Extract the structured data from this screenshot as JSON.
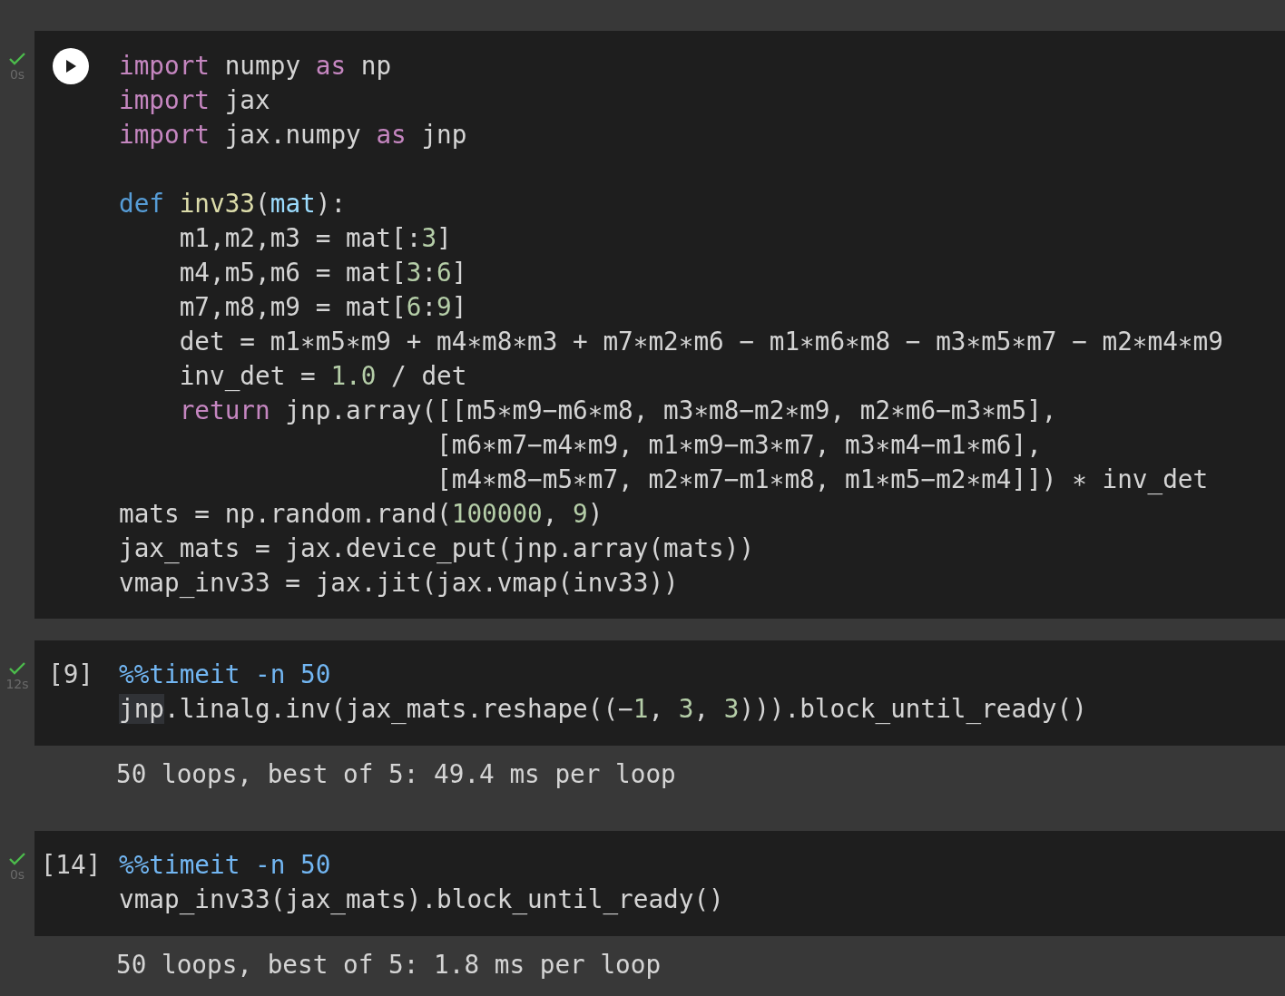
{
  "cells": [
    {
      "succeeded": true,
      "time": "0s",
      "prompt": {
        "kind": "run_button"
      },
      "lines": [
        {
          "kind": "code",
          "indented": false,
          "tokens": [
            {
              "t": "import",
              "kind": "keyword"
            },
            {
              "t": " numpy ",
              "kind": "plain"
            },
            {
              "t": "as",
              "kind": "keyword"
            },
            {
              "t": " np",
              "kind": "plain"
            }
          ]
        },
        {
          "kind": "code",
          "indented": false,
          "tokens": [
            {
              "t": "import",
              "kind": "keyword"
            },
            {
              "t": " jax",
              "kind": "plain"
            }
          ]
        },
        {
          "kind": "code",
          "indented": false,
          "tokens": [
            {
              "t": "import",
              "kind": "keyword"
            },
            {
              "t": " jax.numpy ",
              "kind": "plain"
            },
            {
              "t": "as",
              "kind": "keyword"
            },
            {
              "t": " jnp",
              "kind": "plain"
            }
          ]
        },
        {
          "kind": "blank"
        },
        {
          "kind": "code",
          "indented": false,
          "tokens": [
            {
              "t": "def",
              "kind": "def"
            },
            {
              "t": " inv33",
              "kind": "func"
            },
            {
              "t": "(",
              "kind": "plain"
            },
            {
              "t": "mat",
              "kind": "param"
            },
            {
              "t": "):",
              "kind": "plain"
            }
          ]
        },
        {
          "kind": "code",
          "indented": true,
          "tokens": [
            {
              "t": "m1,m2,m3 = mat[:",
              "kind": "plain"
            },
            {
              "t": "3",
              "kind": "number"
            },
            {
              "t": "]",
              "kind": "plain"
            }
          ]
        },
        {
          "kind": "code",
          "indented": true,
          "tokens": [
            {
              "t": "m4,m5,m6 = mat[",
              "kind": "plain"
            },
            {
              "t": "3",
              "kind": "number"
            },
            {
              "t": ":",
              "kind": "plain"
            },
            {
              "t": "6",
              "kind": "number"
            },
            {
              "t": "]",
              "kind": "plain"
            }
          ]
        },
        {
          "kind": "code",
          "indented": true,
          "tokens": [
            {
              "t": "m7,m8,m9 = mat[",
              "kind": "plain"
            },
            {
              "t": "6",
              "kind": "number"
            },
            {
              "t": ":",
              "kind": "plain"
            },
            {
              "t": "9",
              "kind": "number"
            },
            {
              "t": "]",
              "kind": "plain"
            }
          ]
        },
        {
          "kind": "code",
          "indented": true,
          "tokens": [
            {
              "t": "det = m1∗m5∗m9 + m4∗m8∗m3 + m7∗m2∗m6 − m1∗m6∗m8 − m3∗m5∗m7 − m2∗m4∗m9",
              "kind": "plain"
            }
          ]
        },
        {
          "kind": "code",
          "indented": true,
          "tokens": [
            {
              "t": "inv_det = ",
              "kind": "plain"
            },
            {
              "t": "1.0",
              "kind": "number"
            },
            {
              "t": " / det",
              "kind": "plain"
            }
          ]
        },
        {
          "kind": "code",
          "indented": true,
          "tokens": [
            {
              "t": "return",
              "kind": "keyword"
            },
            {
              "t": " jnp.array([[m5∗m9−m6∗m8, m3∗m8−m2∗m9, m2∗m6−m3∗m5],",
              "kind": "plain"
            }
          ]
        },
        {
          "kind": "code",
          "indented": true,
          "tokens": [
            {
              "t": "                 [m6∗m7−m4∗m9, m1∗m9−m3∗m7, m3∗m4−m1∗m6],",
              "kind": "plain"
            }
          ]
        },
        {
          "kind": "code",
          "indented": true,
          "tokens": [
            {
              "t": "                 [m4∗m8−m5∗m7, m2∗m7−m1∗m8, m1∗m5−m2∗m4]]) ∗ inv_det",
              "kind": "plain"
            }
          ]
        },
        {
          "kind": "code",
          "indented": false,
          "tokens": [
            {
              "t": "mats = np.random.rand(",
              "kind": "plain"
            },
            {
              "t": "100000",
              "kind": "number"
            },
            {
              "t": ", ",
              "kind": "plain"
            },
            {
              "t": "9",
              "kind": "number"
            },
            {
              "t": ")",
              "kind": "plain"
            }
          ]
        },
        {
          "kind": "code",
          "indented": false,
          "tokens": [
            {
              "t": "jax_mats = jax.device_put(jnp.array(mats))",
              "kind": "plain"
            }
          ]
        },
        {
          "kind": "code",
          "indented": false,
          "tokens": [
            {
              "t": "vmap_inv33 = jax.jit(jax.vmap(inv33))",
              "kind": "plain"
            }
          ]
        }
      ]
    },
    {
      "succeeded": true,
      "time": "12s",
      "prompt": {
        "kind": "count",
        "text": "[9]"
      },
      "lines": [
        {
          "kind": "code",
          "indented": false,
          "tokens": [
            {
              "t": "%%timeit -n 50",
              "kind": "magic"
            }
          ]
        },
        {
          "kind": "code",
          "indented": false,
          "tokens": [
            {
              "t": "jnp",
              "kind": "plain",
              "highlighted": true
            },
            {
              "t": ".linalg.inv(jax_mats.reshape((−",
              "kind": "plain"
            },
            {
              "t": "1",
              "kind": "number"
            },
            {
              "t": ", ",
              "kind": "plain"
            },
            {
              "t": "3",
              "kind": "number"
            },
            {
              "t": ", ",
              "kind": "plain"
            },
            {
              "t": "3",
              "kind": "number"
            },
            {
              "t": "))).block_until_ready()",
              "kind": "plain"
            }
          ]
        }
      ],
      "output": "50 loops, best of 5: 49.4 ms per loop"
    },
    {
      "succeeded": true,
      "time": "0s",
      "prompt": {
        "kind": "count",
        "text": "[14]"
      },
      "lines": [
        {
          "kind": "code",
          "indented": false,
          "tokens": [
            {
              "t": "%%timeit -n 50",
              "kind": "magic"
            }
          ]
        },
        {
          "kind": "code",
          "indented": false,
          "tokens": [
            {
              "t": "vmap_inv33(jax_mats).block_until_ready()",
              "kind": "plain"
            }
          ]
        }
      ],
      "output": "50 loops, best of 5: 1.8 ms per loop"
    }
  ]
}
